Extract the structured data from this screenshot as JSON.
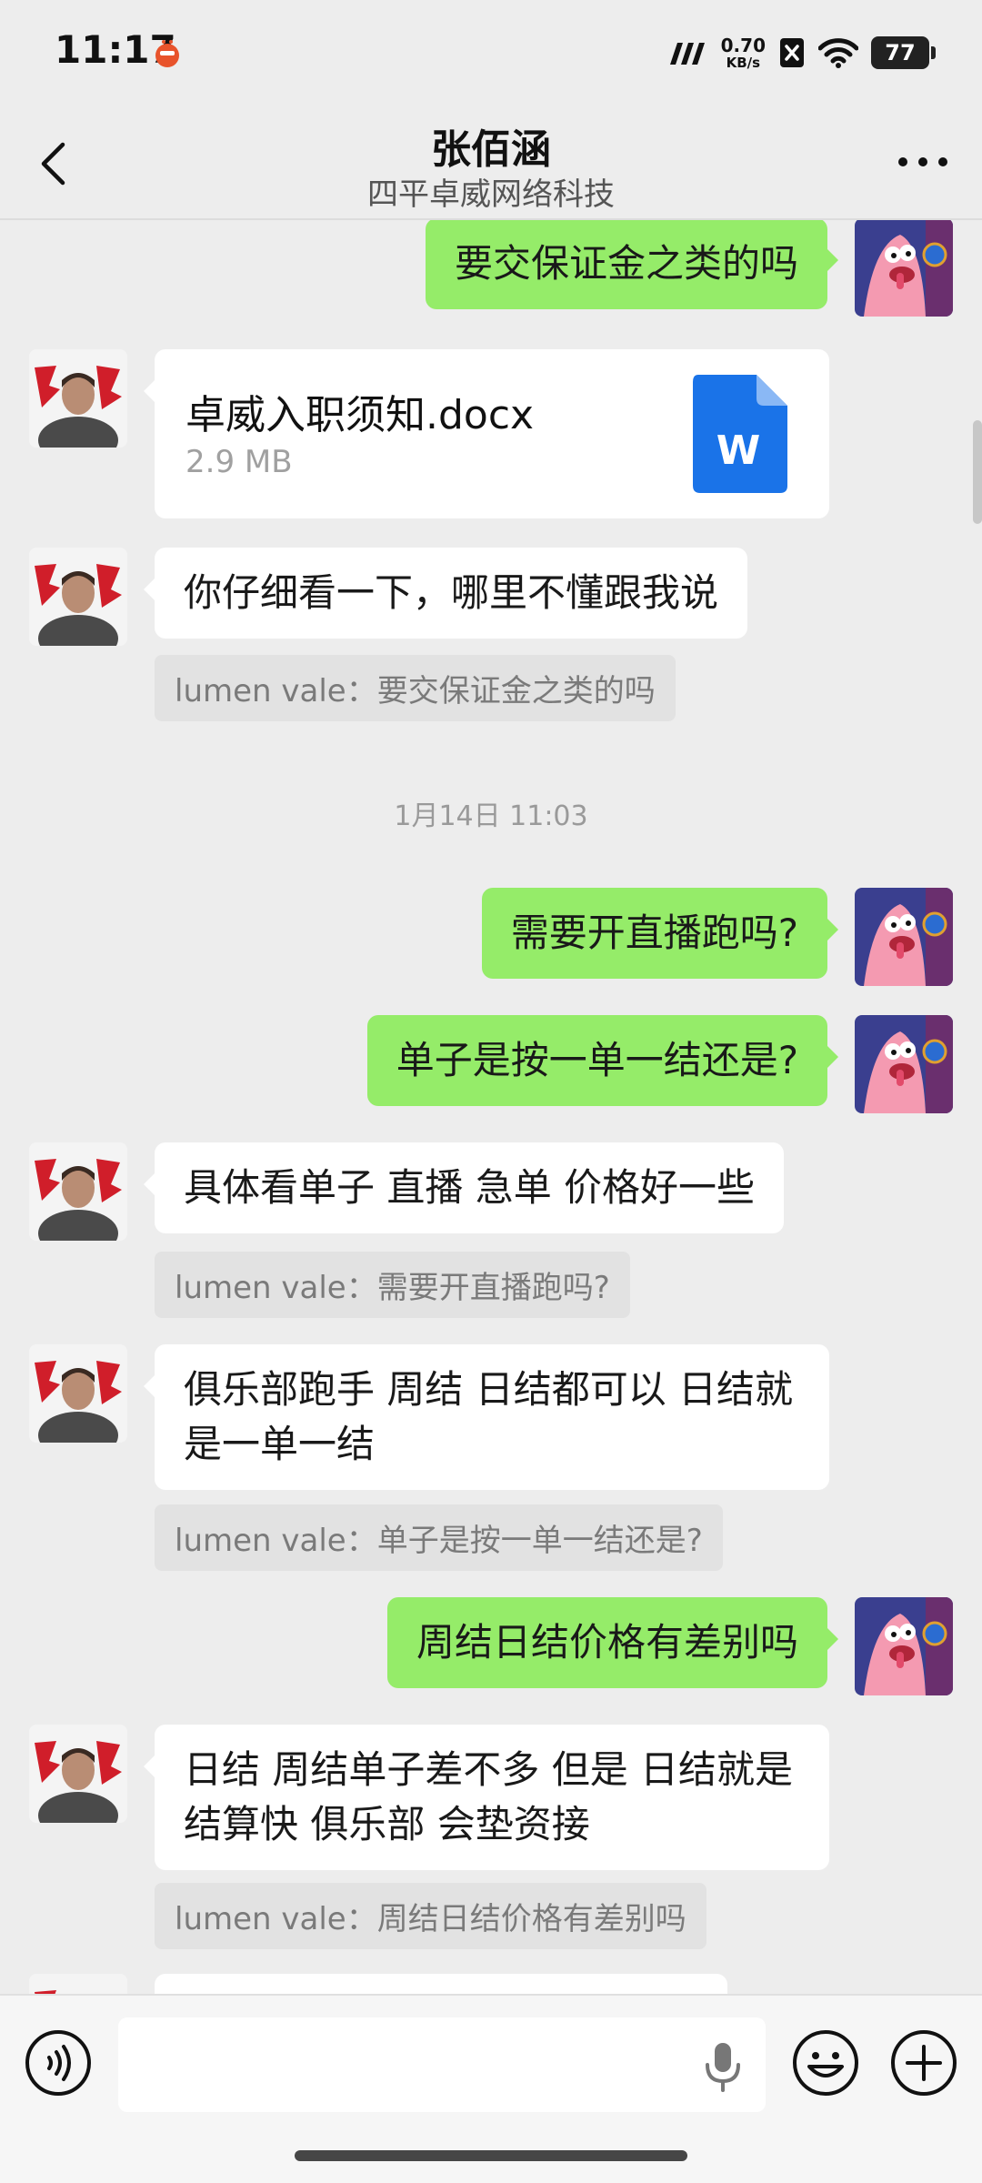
{
  "status_bar": {
    "time": "11:17",
    "net_speed": "0.70",
    "net_unit": "KB/s",
    "battery": "77",
    "signal_label": "ᗰ"
  },
  "header": {
    "title": "张佰涵",
    "subtitle": "四平卓威网络科技"
  },
  "messages": {
    "m1": "要交保证金之类的吗",
    "file": {
      "name": "卓威入职须知.docx",
      "size": "2.9 MB",
      "icon_letter": "W"
    },
    "m2": "你仔细看一下，哪里不懂跟我说",
    "q2": "lumen vale：要交保证金之类的吗",
    "time_sep": "1月14日 11:03",
    "m3": "需要开直播跑吗?",
    "m4": "单子是按一单一结还是?",
    "m5": "具体看单子 直播 急单 价格好一些",
    "q5": "lumen vale：需要开直播跑吗?",
    "m6": "俱乐部跑手 周结 日结都可以  日结就是一单一结",
    "q6": "lumen vale：单子是按一单一结还是?",
    "m7": "周结日结价格有差别吗",
    "m8": "日结 周结单子差不多 但是 日结就是 结算快 俱乐部 会垫资接",
    "q8": "lumen vale：周结日结价格有差别吗"
  },
  "input": {
    "value": "",
    "placeholder": ""
  },
  "colors": {
    "outgoing_bubble": "#95ec69",
    "incoming_bubble": "#ffffff",
    "background": "#ededed",
    "word_icon": "#1a73e8"
  },
  "icons": [
    "back-arrow-icon",
    "more-icon",
    "voice-icon",
    "microphone-icon",
    "emoji-icon",
    "plus-icon",
    "word-document-icon",
    "wifi-icon",
    "battery-icon"
  ]
}
